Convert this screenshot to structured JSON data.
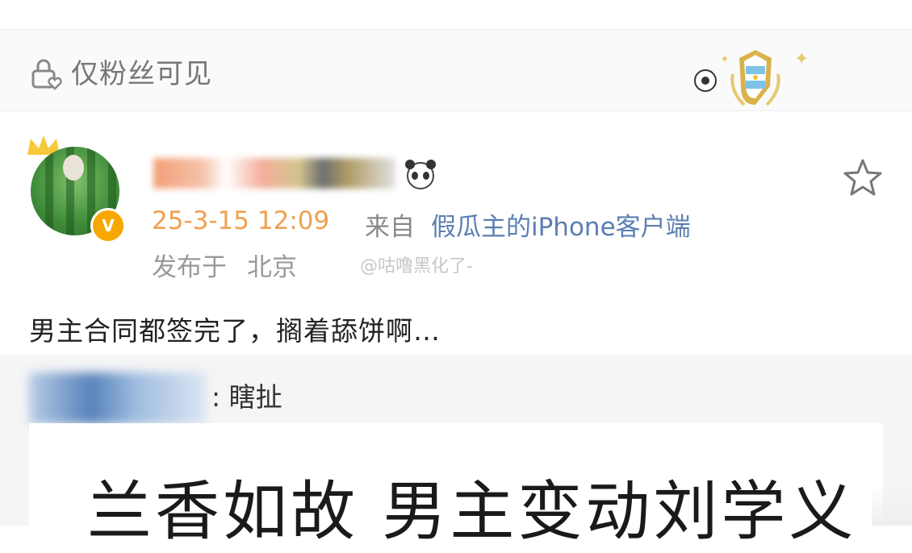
{
  "visibility": {
    "label": "仅粉丝可见",
    "icon": "lock-heart-icon"
  },
  "badge": {
    "icon": "argentina-shield-badge-icon"
  },
  "post": {
    "avatar_icon": "avatar",
    "crown_icon": "crown-icon",
    "verified_icon": "verified-v-icon",
    "sticker_icon": "panda-icon",
    "star_icon": "star-outline-icon",
    "time": "25-3-15 12:09",
    "from_label": "来自",
    "client": "假瓜主的iPhone客户端",
    "location_label": "发布于",
    "location": "北京",
    "watermark": "@咕噜黑化了-",
    "content": "男主合同都签完了，搁着舔饼啊…"
  },
  "repost": {
    "text": ": 瞎扯",
    "card_title": "兰香如故  男主变动刘学义"
  },
  "colors": {
    "time": "#f0a050",
    "client": "#5b7fb0",
    "verified": "#f6a800"
  }
}
